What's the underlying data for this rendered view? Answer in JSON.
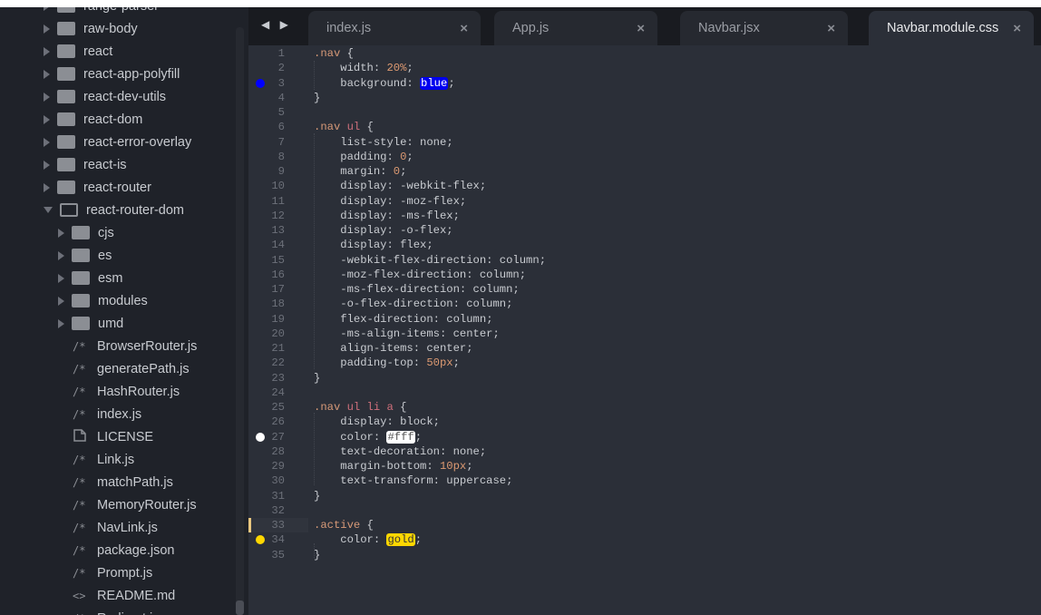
{
  "sidebar": {
    "items": [
      {
        "label": "range-parser",
        "type": "folder",
        "depth": 0
      },
      {
        "label": "raw-body",
        "type": "folder",
        "depth": 0
      },
      {
        "label": "react",
        "type": "folder",
        "depth": 0
      },
      {
        "label": "react-app-polyfill",
        "type": "folder",
        "depth": 0
      },
      {
        "label": "react-dev-utils",
        "type": "folder",
        "depth": 0
      },
      {
        "label": "react-dom",
        "type": "folder",
        "depth": 0
      },
      {
        "label": "react-error-overlay",
        "type": "folder",
        "depth": 0
      },
      {
        "label": "react-is",
        "type": "folder",
        "depth": 0
      },
      {
        "label": "react-router",
        "type": "folder",
        "depth": 0
      },
      {
        "label": "react-router-dom",
        "type": "folder-open",
        "depth": 0
      },
      {
        "label": "cjs",
        "type": "folder",
        "depth": 1
      },
      {
        "label": "es",
        "type": "folder",
        "depth": 1
      },
      {
        "label": "esm",
        "type": "folder",
        "depth": 1
      },
      {
        "label": "modules",
        "type": "folder",
        "depth": 1
      },
      {
        "label": "umd",
        "type": "folder",
        "depth": 1
      },
      {
        "label": "BrowserRouter.js",
        "type": "js",
        "depth": 1
      },
      {
        "label": "generatePath.js",
        "type": "js",
        "depth": 1
      },
      {
        "label": "HashRouter.js",
        "type": "js",
        "depth": 1
      },
      {
        "label": "index.js",
        "type": "js",
        "depth": 1
      },
      {
        "label": "LICENSE",
        "type": "file",
        "depth": 1
      },
      {
        "label": "Link.js",
        "type": "js",
        "depth": 1
      },
      {
        "label": "matchPath.js",
        "type": "js",
        "depth": 1
      },
      {
        "label": "MemoryRouter.js",
        "type": "js",
        "depth": 1
      },
      {
        "label": "NavLink.js",
        "type": "js",
        "depth": 1
      },
      {
        "label": "package.json",
        "type": "js",
        "depth": 1
      },
      {
        "label": "Prompt.js",
        "type": "js",
        "depth": 1
      },
      {
        "label": "README.md",
        "type": "md",
        "depth": 1
      },
      {
        "label": "Redirect.js",
        "type": "js",
        "depth": 1
      }
    ]
  },
  "icons": {
    "js": "/*",
    "md": "<>",
    "file": "file-icon",
    "folder": "folder-icon",
    "close": "×",
    "nav": "◀ ▶"
  },
  "tabs": [
    {
      "label": "index.js",
      "active": false
    },
    {
      "label": "App.js",
      "active": false
    },
    {
      "label": "Navbar.jsx",
      "active": false
    },
    {
      "label": "Navbar.module.css",
      "active": true
    }
  ],
  "editor": {
    "current_line": 33,
    "lines": [
      [
        [
          "sel",
          ".nav"
        ],
        [
          "punc",
          " {"
        ]
      ],
      [
        [
          "prop",
          "    width"
        ],
        [
          "punc",
          ": "
        ],
        [
          "num",
          "20%"
        ],
        [
          "punc",
          ";"
        ]
      ],
      [
        [
          "prop",
          "    background"
        ],
        [
          "punc",
          ": "
        ],
        [
          "sw:#0000ee:#fff",
          "blue"
        ],
        [
          "punc",
          ";"
        ]
      ],
      [
        [
          "punc",
          "}"
        ]
      ],
      [],
      [
        [
          "sel",
          ".nav"
        ],
        [
          "tag",
          " ul"
        ],
        [
          "punc",
          " {"
        ]
      ],
      [
        [
          "prop",
          "    list-style"
        ],
        [
          "punc",
          ": "
        ],
        [
          "val",
          "none"
        ],
        [
          "punc",
          ";"
        ]
      ],
      [
        [
          "prop",
          "    padding"
        ],
        [
          "punc",
          ": "
        ],
        [
          "num",
          "0"
        ],
        [
          "punc",
          ";"
        ]
      ],
      [
        [
          "prop",
          "    margin"
        ],
        [
          "punc",
          ": "
        ],
        [
          "num",
          "0"
        ],
        [
          "punc",
          ";"
        ]
      ],
      [
        [
          "prop",
          "    display"
        ],
        [
          "punc",
          ": "
        ],
        [
          "val",
          "-webkit-flex"
        ],
        [
          "punc",
          ";"
        ]
      ],
      [
        [
          "prop",
          "    display"
        ],
        [
          "punc",
          ": "
        ],
        [
          "val",
          "-moz-flex"
        ],
        [
          "punc",
          ";"
        ]
      ],
      [
        [
          "prop",
          "    display"
        ],
        [
          "punc",
          ": "
        ],
        [
          "val",
          "-ms-flex"
        ],
        [
          "punc",
          ";"
        ]
      ],
      [
        [
          "prop",
          "    display"
        ],
        [
          "punc",
          ": "
        ],
        [
          "val",
          "-o-flex"
        ],
        [
          "punc",
          ";"
        ]
      ],
      [
        [
          "prop",
          "    display"
        ],
        [
          "punc",
          ": "
        ],
        [
          "val",
          "flex"
        ],
        [
          "punc",
          ";"
        ]
      ],
      [
        [
          "prop",
          "    -webkit-flex-direction"
        ],
        [
          "punc",
          ": "
        ],
        [
          "val",
          "column"
        ],
        [
          "punc",
          ";"
        ]
      ],
      [
        [
          "prop",
          "    -moz-flex-direction"
        ],
        [
          "punc",
          ": "
        ],
        [
          "val",
          "column"
        ],
        [
          "punc",
          ";"
        ]
      ],
      [
        [
          "prop",
          "    -ms-flex-direction"
        ],
        [
          "punc",
          ": "
        ],
        [
          "val",
          "column"
        ],
        [
          "punc",
          ";"
        ]
      ],
      [
        [
          "prop",
          "    -o-flex-direction"
        ],
        [
          "punc",
          ": "
        ],
        [
          "val",
          "column"
        ],
        [
          "punc",
          ";"
        ]
      ],
      [
        [
          "prop",
          "    flex-direction"
        ],
        [
          "punc",
          ": "
        ],
        [
          "val",
          "column"
        ],
        [
          "punc",
          ";"
        ]
      ],
      [
        [
          "prop",
          "    -ms-align-items"
        ],
        [
          "punc",
          ": "
        ],
        [
          "val",
          "center"
        ],
        [
          "punc",
          ";"
        ]
      ],
      [
        [
          "prop",
          "    align-items"
        ],
        [
          "punc",
          ": "
        ],
        [
          "val",
          "center"
        ],
        [
          "punc",
          ";"
        ]
      ],
      [
        [
          "prop",
          "    padding-top"
        ],
        [
          "punc",
          ": "
        ],
        [
          "num",
          "50px"
        ],
        [
          "punc",
          ";"
        ]
      ],
      [
        [
          "punc",
          "}"
        ]
      ],
      [],
      [
        [
          "sel",
          ".nav"
        ],
        [
          "tag",
          " ul li a"
        ],
        [
          "punc",
          " {"
        ]
      ],
      [
        [
          "prop",
          "    display"
        ],
        [
          "punc",
          ": "
        ],
        [
          "val",
          "block"
        ],
        [
          "punc",
          ";"
        ]
      ],
      [
        [
          "prop",
          "    color"
        ],
        [
          "punc",
          ": "
        ],
        [
          "sw:#ffffff:#555",
          "#fff"
        ],
        [
          "punc",
          ";"
        ]
      ],
      [
        [
          "prop",
          "    text-decoration"
        ],
        [
          "punc",
          ": "
        ],
        [
          "val",
          "none"
        ],
        [
          "punc",
          ";"
        ]
      ],
      [
        [
          "prop",
          "    margin-bottom"
        ],
        [
          "punc",
          ": "
        ],
        [
          "num",
          "10px"
        ],
        [
          "punc",
          ";"
        ]
      ],
      [
        [
          "prop",
          "    text-transform"
        ],
        [
          "punc",
          ": "
        ],
        [
          "val",
          "uppercase"
        ],
        [
          "punc",
          ";"
        ]
      ],
      [
        [
          "punc",
          "}"
        ]
      ],
      [],
      [
        [
          "sel",
          ".active"
        ],
        [
          "punc",
          " {"
        ]
      ],
      [
        [
          "prop",
          "    color"
        ],
        [
          "punc",
          ": "
        ],
        [
          "sw:#ffd700:#333",
          "gold"
        ],
        [
          "punc",
          ";"
        ]
      ],
      [
        [
          "punc",
          "}"
        ]
      ]
    ],
    "color_dots": {
      "3": "#0000ff",
      "27": "#ffffff",
      "34": "#ffd700"
    }
  }
}
